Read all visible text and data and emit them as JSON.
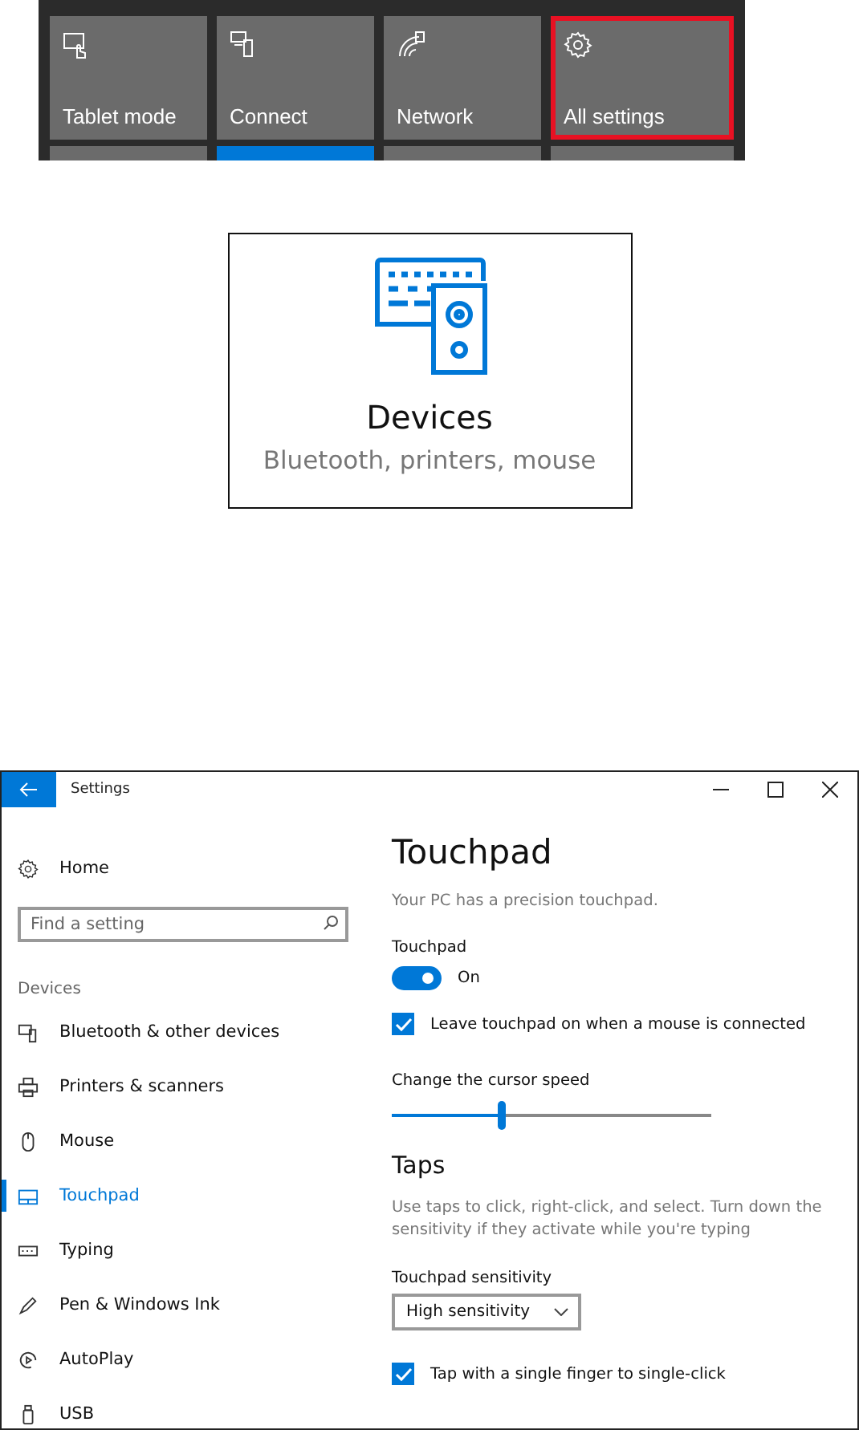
{
  "quick_actions": [
    {
      "label": "Tablet mode",
      "kind": "tablet",
      "active": false,
      "highlighted": false
    },
    {
      "label": "Connect",
      "kind": "connect",
      "active": true,
      "highlighted": false
    },
    {
      "label": "Network",
      "kind": "network",
      "active": false,
      "highlighted": false
    },
    {
      "label": "All settings",
      "kind": "settings",
      "active": false,
      "highlighted": true
    }
  ],
  "category_card": {
    "title": "Devices",
    "subtitle": "Bluetooth, printers, mouse"
  },
  "settings_window": {
    "title": "Settings",
    "sidebar": {
      "home": "Home",
      "search": {
        "placeholder": "Find a setting"
      },
      "section": "Devices",
      "items": [
        {
          "label": "Bluetooth & other devices",
          "kind": "bluetooth",
          "selected": false
        },
        {
          "label": "Printers & scanners",
          "kind": "printer",
          "selected": false
        },
        {
          "label": "Mouse",
          "kind": "mouse",
          "selected": false
        },
        {
          "label": "Touchpad",
          "kind": "touchpad",
          "selected": true
        },
        {
          "label": "Typing",
          "kind": "keyboard",
          "selected": false
        },
        {
          "label": "Pen & Windows Ink",
          "kind": "pen",
          "selected": false
        },
        {
          "label": "AutoPlay",
          "kind": "autoplay",
          "selected": false
        },
        {
          "label": "USB",
          "kind": "usb",
          "selected": false
        }
      ]
    },
    "content": {
      "title": "Touchpad",
      "description": "Your PC has a precision touchpad.",
      "toggle": {
        "label": "Touchpad",
        "on": true,
        "state_text": "On"
      },
      "leave_on": {
        "label": "Leave touchpad on when a mouse is connected",
        "checked": true
      },
      "cursor_speed": {
        "label": "Change the cursor speed",
        "level": 0.34
      },
      "taps": {
        "heading": "Taps",
        "description": "Use taps to click, right-click, and select. Turn down the sensitivity if they activate while you're typing",
        "sensitivity": {
          "label": "Touchpad sensitivity",
          "value": "High sensitivity"
        },
        "single_tap": {
          "label": "Tap with a single finger to single-click",
          "checked": true
        }
      }
    }
  }
}
